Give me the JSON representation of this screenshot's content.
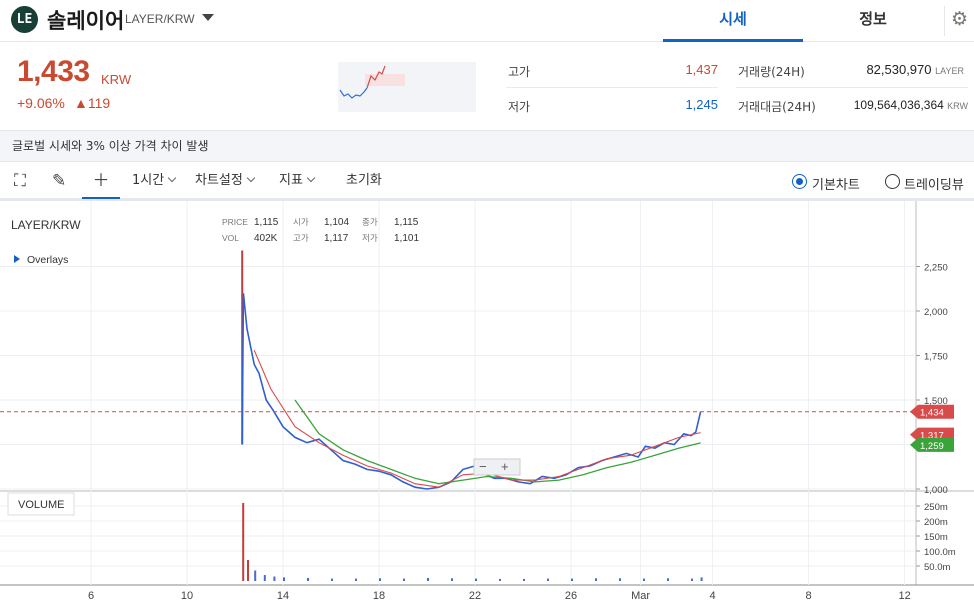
{
  "header": {
    "logo_text": "LE",
    "coin_name": "솔레이어",
    "pair": "LAYER/KRW",
    "tabs": [
      "시세",
      "정보"
    ]
  },
  "price": {
    "current": "1,433",
    "unit": "KRW",
    "change_pct": "+9.06%",
    "change_amt": "▲119"
  },
  "stats": {
    "high_label": "고가",
    "high_value": "1,437",
    "low_label": "저가",
    "low_value": "1,245",
    "volume_label": "거래량(24H)",
    "volume_value": "82,530,970",
    "volume_unit": "LAYER",
    "amount_label": "거래대금(24H)",
    "amount_value": "109,564,036,364",
    "amount_unit": "KRW"
  },
  "notice": "글로벌 시세와 3% 이상 가격 차이 발생",
  "toolbar": {
    "interval": "1시간",
    "chart_settings": "차트설정",
    "indicators": "지표",
    "reset": "초기화",
    "radio_basic": "기본차트",
    "radio_tv": "트레이딩뷰"
  },
  "chart_info": {
    "symbol": "LAYER/KRW",
    "overlays": "Overlays",
    "price_label": "PRICE",
    "price_val": "1,115",
    "open_label": "시가",
    "open_val": "1,104",
    "close_label": "종가",
    "close_val": "1,115",
    "vol_label": "VOL",
    "vol_val": "402K",
    "high_label": "고가",
    "high_val": "1,117",
    "low_label": "저가",
    "low_val": "1,101",
    "volume_panel": "VOLUME"
  },
  "chart_data": {
    "type": "line",
    "x_ticks": [
      "6",
      "10",
      "14",
      "18",
      "22",
      "26",
      "Mar",
      "4",
      "8",
      "12"
    ],
    "y_ticks": [
      "2,250",
      "2,000",
      "1,750",
      "1,500",
      "1,250",
      "1,000"
    ],
    "volume_ticks": [
      "250m",
      "200m",
      "150m",
      "100.0m",
      "50.0m"
    ],
    "price_tags": [
      {
        "value": "1,434",
        "color": "#d94a4a"
      },
      {
        "value": "1,317",
        "color": "#d94a4a"
      },
      {
        "value": "1,259",
        "color": "#3aa33a"
      }
    ],
    "ylim": [
      900,
      2350
    ],
    "price_series": [
      [
        12.3,
        1250
      ],
      [
        12.35,
        2100
      ],
      [
        12.5,
        1900
      ],
      [
        12.8,
        1700
      ],
      [
        13.0,
        1650
      ],
      [
        13.3,
        1500
      ],
      [
        13.6,
        1440
      ],
      [
        14.0,
        1350
      ],
      [
        14.5,
        1290
      ],
      [
        15.0,
        1260
      ],
      [
        15.5,
        1280
      ],
      [
        16.0,
        1220
      ],
      [
        16.5,
        1160
      ],
      [
        17.0,
        1140
      ],
      [
        17.5,
        1110
      ],
      [
        18.0,
        1100
      ],
      [
        18.5,
        1080
      ],
      [
        19.0,
        1040
      ],
      [
        19.5,
        1010
      ],
      [
        20.0,
        1000
      ],
      [
        20.5,
        1010
      ],
      [
        21.0,
        1040
      ],
      [
        21.5,
        1110
      ],
      [
        22.0,
        1130
      ],
      [
        22.3,
        1090
      ],
      [
        22.8,
        1060
      ],
      [
        23.3,
        1060
      ],
      [
        23.8,
        1040
      ],
      [
        24.3,
        1030
      ],
      [
        24.8,
        1070
      ],
      [
        25.3,
        1060
      ],
      [
        25.8,
        1080
      ],
      [
        26.3,
        1120
      ],
      [
        26.8,
        1130
      ],
      [
        27.3,
        1160
      ],
      [
        27.8,
        1180
      ],
      [
        28.3,
        1200
      ],
      [
        28.8,
        1180
      ],
      [
        29.1,
        1240
      ],
      [
        29.5,
        1230
      ],
      [
        29.9,
        1260
      ],
      [
        30.3,
        1250
      ],
      [
        30.7,
        1310
      ],
      [
        31.0,
        1300
      ],
      [
        31.2,
        1320
      ],
      [
        31.4,
        1434
      ]
    ],
    "ma_red": [
      [
        12.8,
        1780
      ],
      [
        13.5,
        1560
      ],
      [
        14.5,
        1350
      ],
      [
        15.5,
        1260
      ],
      [
        16.5,
        1190
      ],
      [
        17.5,
        1130
      ],
      [
        18.5,
        1090
      ],
      [
        19.5,
        1030
      ],
      [
        20.5,
        1010
      ],
      [
        21.5,
        1080
      ],
      [
        22.5,
        1090
      ],
      [
        23.5,
        1050
      ],
      [
        24.5,
        1050
      ],
      [
        25.5,
        1070
      ],
      [
        26.5,
        1120
      ],
      [
        27.5,
        1170
      ],
      [
        28.5,
        1190
      ],
      [
        29.5,
        1240
      ],
      [
        30.5,
        1290
      ],
      [
        31.4,
        1317
      ]
    ],
    "ma_green": [
      [
        14.5,
        1500
      ],
      [
        15.5,
        1310
      ],
      [
        16.5,
        1220
      ],
      [
        17.5,
        1160
      ],
      [
        18.5,
        1110
      ],
      [
        19.5,
        1060
      ],
      [
        20.5,
        1030
      ],
      [
        21.5,
        1050
      ],
      [
        22.5,
        1070
      ],
      [
        23.5,
        1060
      ],
      [
        24.5,
        1040
      ],
      [
        25.5,
        1050
      ],
      [
        26.5,
        1080
      ],
      [
        27.5,
        1120
      ],
      [
        28.5,
        1150
      ],
      [
        29.5,
        1190
      ],
      [
        30.5,
        1230
      ],
      [
        31.4,
        1259
      ]
    ],
    "volume": [
      [
        12.3,
        260
      ],
      [
        12.5,
        70
      ],
      [
        12.8,
        35
      ],
      [
        13.2,
        20
      ],
      [
        13.6,
        15
      ],
      [
        14.0,
        12
      ],
      [
        15.0,
        10
      ],
      [
        16.0,
        8
      ],
      [
        17.0,
        8
      ],
      [
        18.0,
        9
      ],
      [
        19.0,
        8
      ],
      [
        20.0,
        10
      ],
      [
        21.0,
        9
      ],
      [
        22.0,
        8
      ],
      [
        23.0,
        7
      ],
      [
        24.0,
        7
      ],
      [
        25.0,
        8
      ],
      [
        26.0,
        8
      ],
      [
        27.0,
        9
      ],
      [
        28.0,
        9
      ],
      [
        29.0,
        8
      ],
      [
        30.0,
        9
      ],
      [
        31.0,
        8
      ],
      [
        31.4,
        12
      ]
    ],
    "volume_max": 280
  }
}
